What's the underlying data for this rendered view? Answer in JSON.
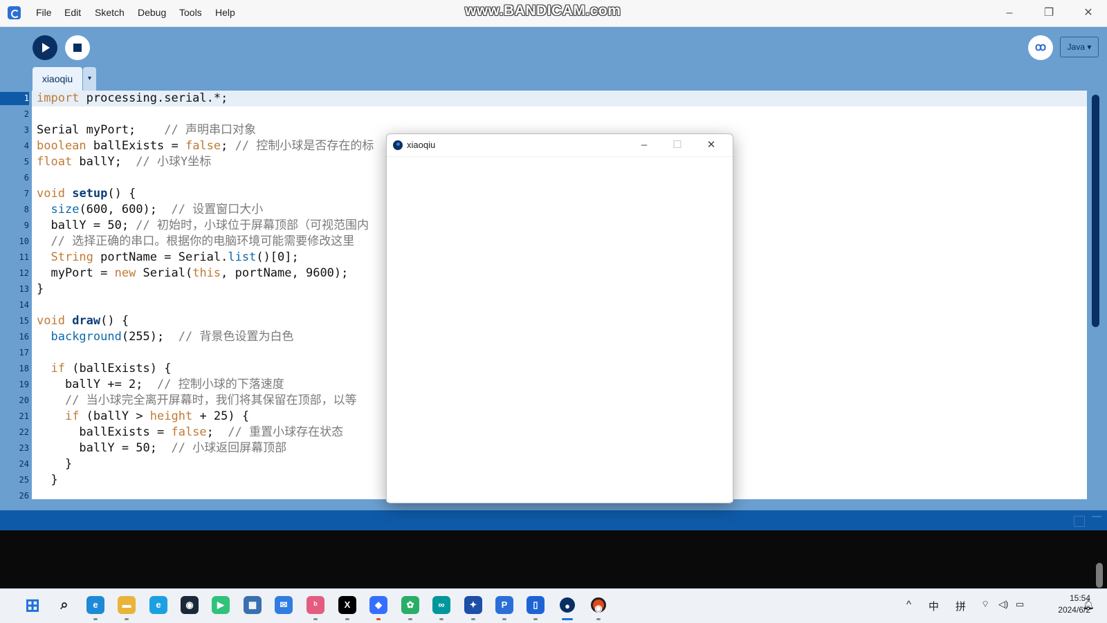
{
  "menubar": {
    "items": [
      "File",
      "Edit",
      "Sketch",
      "Debug",
      "Tools",
      "Help"
    ],
    "watermark": "www.BANDICAM.com"
  },
  "toolbar": {
    "debug_symbol": "ꝏ",
    "mode": "Java ▾"
  },
  "tabs": [
    {
      "label": "xiaoqiu",
      "menu": "▾"
    }
  ],
  "editor": {
    "line_numbers": [
      "1",
      "2",
      "3",
      "4",
      "5",
      "6",
      "7",
      "8",
      "9",
      "10",
      "11",
      "12",
      "13",
      "14",
      "15",
      "16",
      "17",
      "18",
      "19",
      "20",
      "21",
      "22",
      "23",
      "24",
      "25",
      "26"
    ],
    "lines": [
      "import processing.serial.*;",
      "",
      "Serial myPort;    // 声明串口对象",
      "boolean ballExists = false; // 控制小球是否存在的标",
      "float ballY;  // 小球Y坐标",
      "",
      "void setup() {",
      "  size(600, 600);  // 设置窗口大小",
      "  ballY = 50; // 初始时，小球位于屏幕顶部（可视范围内",
      "  // 选择正确的串口。根据你的电脑环境可能需要修改这里",
      "  String portName = Serial.list()[0];",
      "  myPort = new Serial(this, portName, 9600);",
      "}",
      "",
      "void draw() {",
      "  background(255);  // 背景色设置为白色",
      "",
      "  if (ballExists) {",
      "    ballY += 2;  // 控制小球的下落速度",
      "    // 当小球完全离开屏幕时，我们将其保留在顶部，以等",
      "    if (ballY > height + 25) {",
      "      ballExists = false;  // 重置小球存在状态",
      "      ballY = 50;  // 小球返回屏幕顶部",
      "    }",
      "  }",
      ""
    ]
  },
  "sketch_window": {
    "title": "xiaoqiu"
  },
  "taskbar": {
    "apps": [
      {
        "name": "start",
        "color": "#1f6fd9"
      },
      {
        "name": "search",
        "color": "#222222"
      },
      {
        "name": "edge",
        "color": "#1c8ad6"
      },
      {
        "name": "file-explorer",
        "color": "#e8b43a"
      },
      {
        "name": "browser",
        "color": "#1ba1e2"
      },
      {
        "name": "steam",
        "color": "#1b2838"
      },
      {
        "name": "media-player",
        "color": "#31c27c"
      },
      {
        "name": "calendar",
        "color": "#3a6fb0"
      },
      {
        "name": "mail",
        "color": "#2f7de1"
      },
      {
        "name": "bilibili",
        "color": "#e45d80"
      },
      {
        "name": "x",
        "color": "#000000"
      },
      {
        "name": "feishu",
        "color": "#3370ff"
      },
      {
        "name": "wechat",
        "color": "#2aae67"
      },
      {
        "name": "arduino",
        "color": "#00979c"
      },
      {
        "name": "app-blue",
        "color": "#1d4ea8"
      },
      {
        "name": "processing",
        "color": "#2b6fd6"
      },
      {
        "name": "tencent-doc",
        "color": "#1e63d6"
      },
      {
        "name": "sketch-running",
        "color": "#0a2f63"
      },
      {
        "name": "obs",
        "color": "#e04a1c"
      }
    ],
    "tray": {
      "chevron": "^",
      "ime_lang": "中",
      "ime_mode": "拼",
      "time": "15:54",
      "date": "2024/6/2"
    }
  },
  "colors": {
    "accent": "#6a9fd0",
    "dark": "#0a2f63",
    "console": "#0f5aa8"
  }
}
